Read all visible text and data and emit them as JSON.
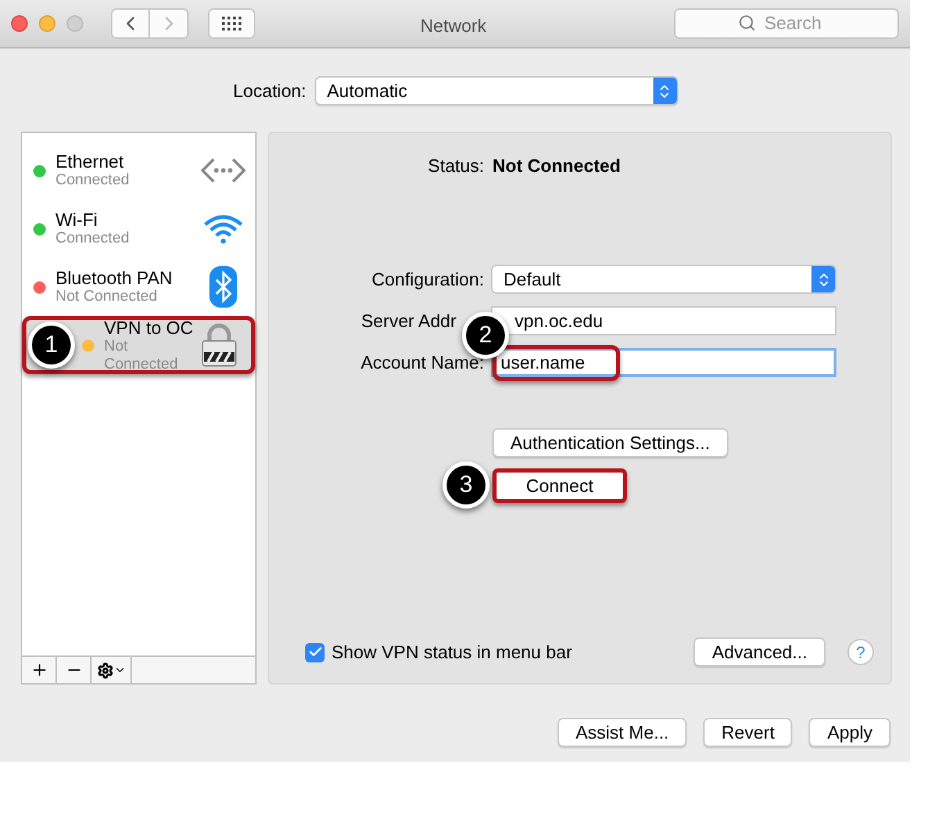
{
  "window": {
    "title": "Network"
  },
  "toolbar": {
    "search": {
      "placeholder": "Search"
    }
  },
  "location": {
    "label": "Location:",
    "value": "Automatic"
  },
  "services": [
    {
      "kind": "ethernet",
      "name": "Ethernet",
      "status": "Connected",
      "color": "#34c84a",
      "selected": false
    },
    {
      "kind": "wifi",
      "name": "Wi-Fi",
      "status": "Connected",
      "color": "#34c84a",
      "selected": false
    },
    {
      "kind": "bluetooth",
      "name": "Bluetooth PAN",
      "status": "Not Connected",
      "color": "#fc605c",
      "selected": false
    },
    {
      "kind": "vpn",
      "name": "VPN to OC",
      "status": "Not Connected",
      "color": "#fdbc40",
      "selected": true
    }
  ],
  "detail": {
    "status": {
      "label": "Status:",
      "value": "Not Connected"
    },
    "fields": [
      {
        "kind": "select",
        "label": "Configuration:",
        "value": "Default",
        "focused": false
      },
      {
        "kind": "text",
        "label": "Server Addr",
        "value": "vpn.oc.edu",
        "focused": false
      },
      {
        "kind": "text",
        "label": "Account Name:",
        "value": "user.name",
        "focused": true
      }
    ],
    "auth_button": "Authentication Settings...",
    "connect_button": "Connect",
    "show_status": {
      "label": "Show VPN status in menu bar",
      "checked": true
    },
    "advanced_button": "Advanced...",
    "help": "?"
  },
  "buttons": [
    "Assist Me...",
    "Revert",
    "Apply"
  ],
  "callouts": [
    "1",
    "2",
    "3"
  ]
}
